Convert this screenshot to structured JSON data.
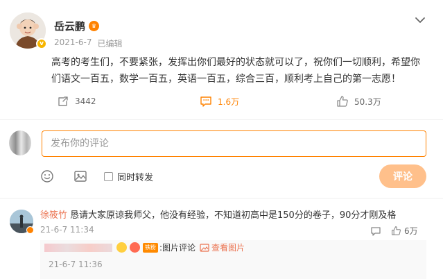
{
  "post": {
    "author": "岳云鹏",
    "date": "2021-6-7",
    "edited": "已编辑",
    "text": "高考的考生们，不要紧张，发挥出你们最好的状态就可以了，祝你们一切顺利，希望你们语文一百五，数学一百五，英语一百五，综合三百，顺利考上自己的第一志愿！",
    "reposts": "3442",
    "comments": "1.6万",
    "likes": "50.3万"
  },
  "composer": {
    "placeholder": "发布你的评论",
    "repost_label": "同时转发",
    "submit_label": "评论"
  },
  "comment": {
    "author": "徐筱竹",
    "text": "恳请大家原谅我师父，他没有经验，不知道初高中是150分的卷子，90分才刚及格",
    "time": "21-6-7 11:34",
    "likes": "6万"
  },
  "reply": {
    "fan_badge": "铁粉",
    "text": ":图片评论",
    "view_image": "查看图片",
    "time": "21-6-7 11:36"
  },
  "colors": {
    "accent": "#ff8200",
    "link": "#eb7350",
    "submit_disabled": "#ffc08b"
  },
  "icons": [
    "vip-icon",
    "chevron-down-icon",
    "repost-icon",
    "comment-icon",
    "like-icon",
    "emoji-icon",
    "image-icon",
    "reply-icon",
    "picture-icon"
  ]
}
